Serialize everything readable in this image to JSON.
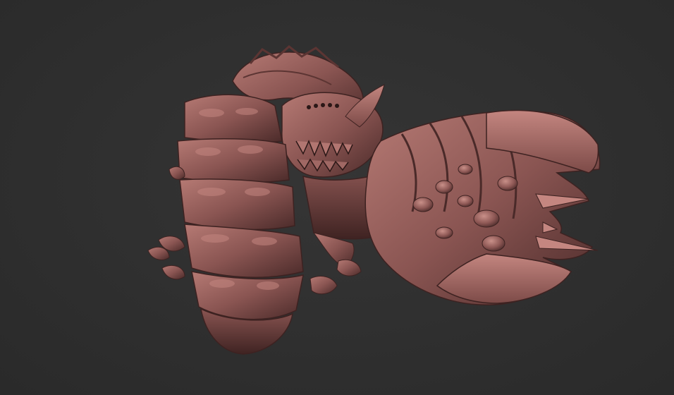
{
  "viewport": {
    "background": "#2f2f2f"
  },
  "model": {
    "name": "",
    "material_color": "#8a5552",
    "highlight_color": "#b67a74",
    "shadow_color": "#4a2a29"
  }
}
